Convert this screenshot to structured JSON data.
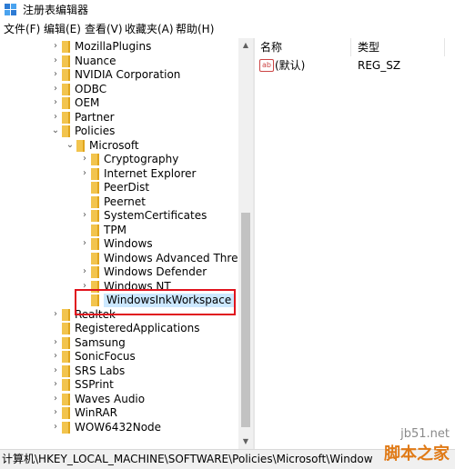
{
  "window": {
    "title": "注册表编辑器"
  },
  "menu": [
    {
      "label": "文件(F)"
    },
    {
      "label": "编辑(E)"
    },
    {
      "label": "查看(V)"
    },
    {
      "label": "收藏夹(A)"
    },
    {
      "label": "帮助(H)"
    }
  ],
  "tree": [
    {
      "label": "MozillaPlugins",
      "expander": "›",
      "level": 0
    },
    {
      "label": "Nuance",
      "expander": "›",
      "level": 0
    },
    {
      "label": "NVIDIA Corporation",
      "expander": "›",
      "level": 0
    },
    {
      "label": "ODBC",
      "expander": "›",
      "level": 0
    },
    {
      "label": "OEM",
      "expander": "›",
      "level": 0
    },
    {
      "label": "Partner",
      "expander": "›",
      "level": 0
    },
    {
      "label": "Policies",
      "expander": "⌄",
      "level": 0
    },
    {
      "label": "Microsoft",
      "expander": "⌄",
      "level": 1
    },
    {
      "label": "Cryptography",
      "expander": "›",
      "level": 2
    },
    {
      "label": "Internet Explorer",
      "expander": "›",
      "level": 2
    },
    {
      "label": "PeerDist",
      "expander": "",
      "level": 2
    },
    {
      "label": "Peernet",
      "expander": "",
      "level": 2
    },
    {
      "label": "SystemCertificates",
      "expander": "›",
      "level": 2
    },
    {
      "label": "TPM",
      "expander": "",
      "level": 2
    },
    {
      "label": "Windows",
      "expander": "›",
      "level": 2
    },
    {
      "label": "Windows Advanced Threat P",
      "expander": "",
      "level": 2
    },
    {
      "label": "Windows Defender",
      "expander": "›",
      "level": 2
    },
    {
      "label": "Windows NT",
      "expander": "›",
      "level": 2
    },
    {
      "label": "WindowsInkWorkspace",
      "expander": "",
      "level": 2,
      "selected": true
    },
    {
      "label": "Realtek",
      "expander": "›",
      "level": 0
    },
    {
      "label": "RegisteredApplications",
      "expander": "",
      "level": 0
    },
    {
      "label": "Samsung",
      "expander": "›",
      "level": 0
    },
    {
      "label": "SonicFocus",
      "expander": "›",
      "level": 0
    },
    {
      "label": "SRS Labs",
      "expander": "›",
      "level": 0
    },
    {
      "label": "SSPrint",
      "expander": "›",
      "level": 0
    },
    {
      "label": "Waves Audio",
      "expander": "›",
      "level": 0
    },
    {
      "label": "WinRAR",
      "expander": "›",
      "level": 0
    },
    {
      "label": "WOW6432Node",
      "expander": "›",
      "level": 0
    }
  ],
  "list": {
    "col_name": "名称",
    "col_type": "类型",
    "rows": [
      {
        "icon": "ab",
        "name": "(默认)",
        "type": "REG_SZ"
      }
    ]
  },
  "statusbar": {
    "path": "计算机\\HKEY_LOCAL_MACHINE\\SOFTWARE\\Policies\\Microsoft\\Window"
  },
  "watermark": {
    "site": "jb51.net",
    "brand": "脚本之家"
  },
  "colors": {
    "highlight_border": "#e0141e",
    "folder": "#f2c44e",
    "selection": "#cce8ff"
  }
}
